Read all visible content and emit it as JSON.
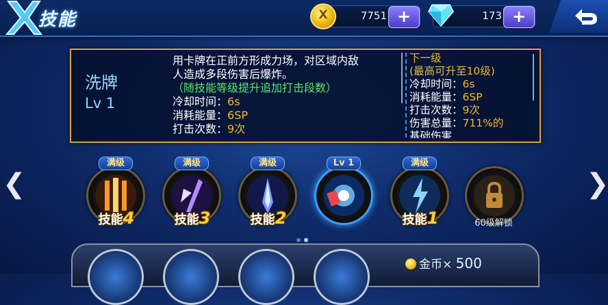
{
  "header": {
    "title": "技能",
    "gold": "7751",
    "gold_icon_text": "X",
    "diamonds": "173",
    "plus_label": "+"
  },
  "panel": {
    "skill_name": "洗牌",
    "skill_level": "Lv 1",
    "desc_lines": [
      {
        "text": "用卡牌在正前方形成力场，对区域内敌",
        "color": "#ffffff"
      },
      {
        "text": "人造成多段伤害后爆炸。",
        "color": "#ffffff"
      },
      {
        "text": "（随技能等级提升追加打击段数）",
        "color": "#5fe66a"
      }
    ],
    "stats": [
      {
        "label": "冷却时间：",
        "value": "6s"
      },
      {
        "label": "消耗能量：",
        "value": "6SP"
      },
      {
        "label": "打击次数：",
        "value": "9次"
      }
    ],
    "next": {
      "title": "下一级",
      "max_note": "(最高可升至10级)",
      "stats": [
        {
          "label": "冷却时间：",
          "value": "6s"
        },
        {
          "label": "消耗能量：",
          "value": "6SP"
        },
        {
          "label": "打击次数：",
          "value": "9次"
        },
        {
          "label": "伤害总量：",
          "value": "711%的"
        }
      ],
      "cut_line": "基础伤害"
    }
  },
  "skills": [
    {
      "badge": "满级",
      "label": "技能",
      "num": "4",
      "icon": "flame-pillars-icon",
      "color": "#e8862a"
    },
    {
      "badge": "满级",
      "label": "技能",
      "num": "3",
      "icon": "purple-blade-icon",
      "color": "#8a5ae0"
    },
    {
      "badge": "满级",
      "label": "技能",
      "num": "2",
      "icon": "ice-spear-icon",
      "color": "#5a7ae8"
    },
    {
      "badge": "Lv 1",
      "label": "",
      "num": "",
      "icon": "card-shuffle-icon",
      "color": "#3aa0ff"
    },
    {
      "badge": "满级",
      "label": "技能",
      "num": "1",
      "icon": "lightning-icon",
      "color": "#4ab8ff"
    },
    {
      "badge": "",
      "label": "60级解锁",
      "num": "",
      "icon": "lock-icon",
      "color": "#8a6a3a"
    }
  ],
  "bottom": {
    "cost_label": "金币",
    "cost_mult": "×",
    "cost_value": "500"
  },
  "arrows": {
    "left": "❮",
    "right": "❯"
  }
}
